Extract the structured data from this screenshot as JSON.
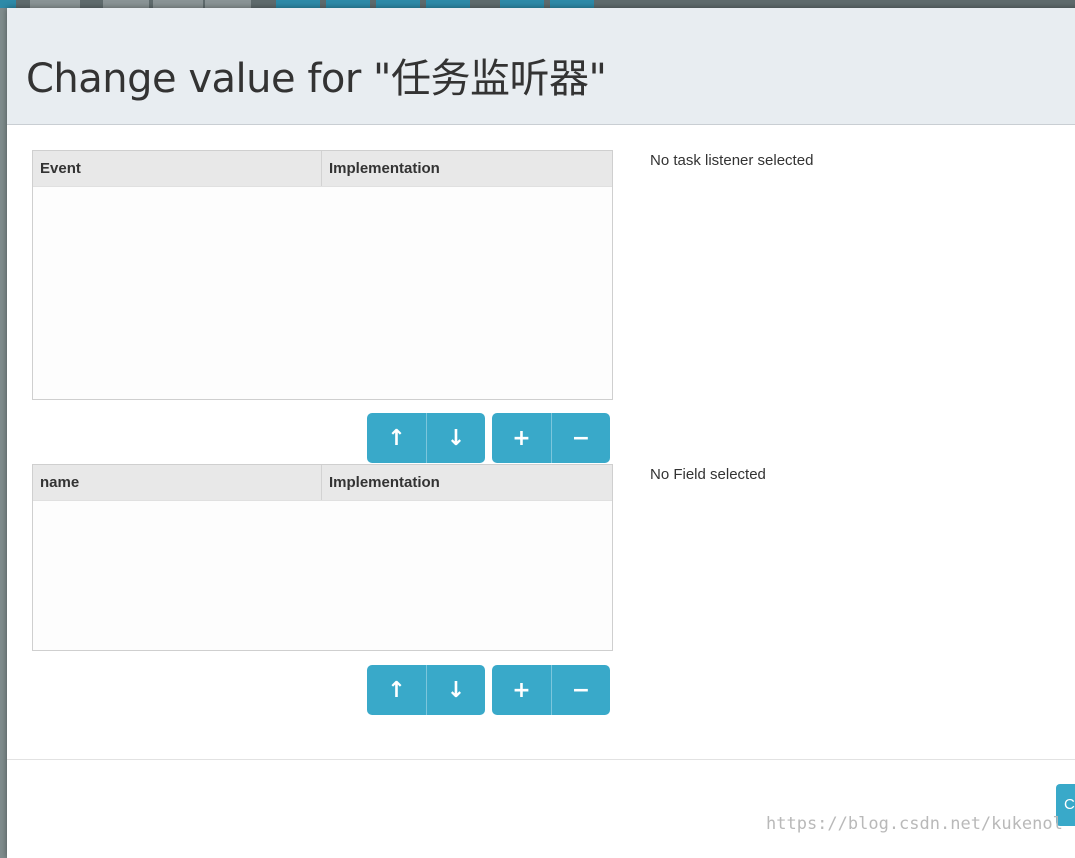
{
  "modal": {
    "title": "Change value for \"任务监听器\""
  },
  "listeners_grid": {
    "columns": [
      "Event",
      "Implementation"
    ],
    "rows": [],
    "empty_message": "No task listener selected"
  },
  "fields_grid": {
    "columns": [
      "name",
      "Implementation"
    ],
    "rows": [],
    "empty_message": "No Field selected"
  },
  "toolbar_icons": {
    "move_up": "↑",
    "move_down": "↓",
    "add": "+",
    "remove": "−"
  },
  "footer": {
    "button_label": "C"
  },
  "watermark": "https://blog.csdn.net/kukenol",
  "colors": {
    "accent": "#39a9c9",
    "header_bg": "#e8edf1",
    "grid_header_bg": "#e8e8e8"
  }
}
